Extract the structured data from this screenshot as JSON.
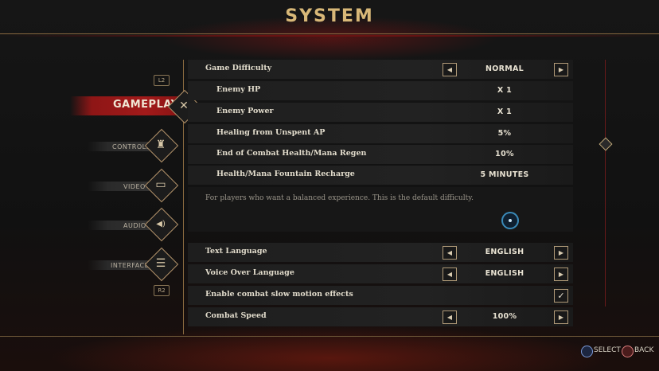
{
  "title": "SYSTEM",
  "nav": {
    "l2": "L2",
    "r2": "R2",
    "items": [
      {
        "label": "GAMEPLAY",
        "icon": "swords-icon",
        "glyph": "✕"
      },
      {
        "label": "CONTROLS",
        "icon": "joystick-icon",
        "glyph": "♜"
      },
      {
        "label": "VIDEO",
        "icon": "monitor-icon",
        "glyph": "▭"
      },
      {
        "label": "AUDIO",
        "icon": "speaker-icon",
        "glyph": "◀)"
      },
      {
        "label": "INTERFACE",
        "icon": "interface-icon",
        "glyph": "☰"
      }
    ]
  },
  "settings": [
    {
      "label": "Game Difficulty",
      "value": "NORMAL",
      "type": "selector"
    },
    {
      "label": "Enemy HP",
      "value": "X 1",
      "type": "sub"
    },
    {
      "label": "Enemy Power",
      "value": "X 1",
      "type": "sub"
    },
    {
      "label": "Healing from Unspent AP",
      "value": "5%",
      "type": "sub"
    },
    {
      "label": "End of Combat Health/Mana Regen",
      "value": "10%",
      "type": "sub"
    },
    {
      "label": "Health/Mana Fountain Recharge",
      "value": "5 MINUTES",
      "type": "sub"
    }
  ],
  "description": "For players who want a balanced experience. This is the default difficulty.",
  "settings2": [
    {
      "label": "Text Language",
      "value": "ENGLISH",
      "type": "selector"
    },
    {
      "label": "Voice Over Language",
      "value": "ENGLISH",
      "type": "selector"
    },
    {
      "label": "Enable combat slow motion effects",
      "value": "✓",
      "type": "checkbox"
    },
    {
      "label": "Combat Speed",
      "value": "100%",
      "type": "selector"
    }
  ],
  "arrows": {
    "left": "◀",
    "right": "▶"
  },
  "footer": {
    "select": "SELECT",
    "back": "BACK"
  },
  "colors": {
    "accent_red": "#a21a1a",
    "gold": "#d8b878",
    "cursor_blue": "#3a8ab8"
  }
}
